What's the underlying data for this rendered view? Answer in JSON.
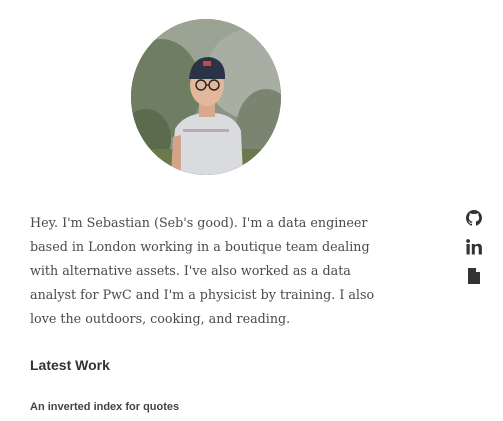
{
  "profile": {
    "avatar_icon": "profile-photo",
    "bio": "Hey. I'm Sebastian (Seb's good). I'm a data engineer based in London working in a boutique team dealing with alternative assets. I've also worked as a data analyst for PwC and I'm a physicist by training. I also love the outdoors, cooking, and reading."
  },
  "social": [
    {
      "icon": "github-icon"
    },
    {
      "icon": "linkedin-icon"
    },
    {
      "icon": "document-icon"
    }
  ],
  "latest_work": {
    "title": "Latest Work",
    "items": [
      {
        "title": "An inverted index for quotes"
      }
    ]
  }
}
